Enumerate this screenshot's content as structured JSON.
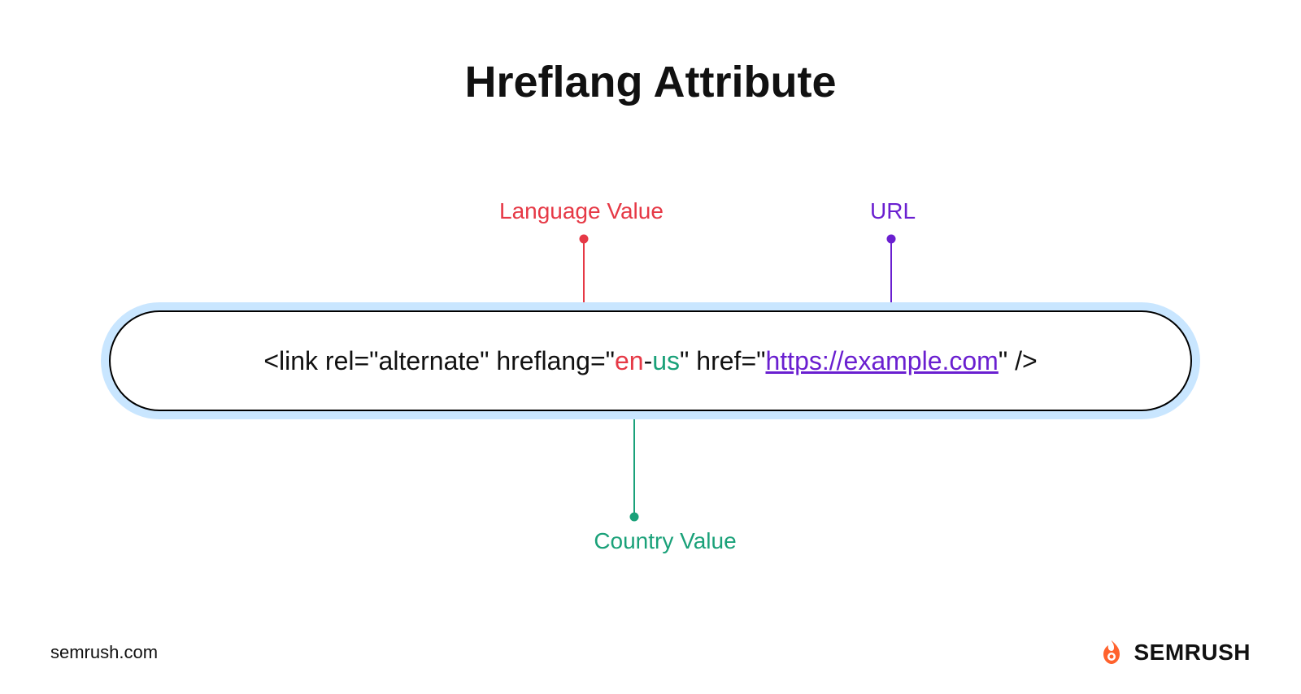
{
  "title": "Hreflang Attribute",
  "annotations": {
    "language": "Language Value",
    "url": "URL",
    "country": "Country Value"
  },
  "code": {
    "prefix": "<link rel=\"alternate\" hreflang=\"",
    "language_token": "en",
    "separator": "-",
    "country_token": "us",
    "mid": "\" href=\"",
    "url_token": "https://example.com",
    "suffix": "\" />"
  },
  "footer": {
    "site": "semrush.com",
    "brand": "SEMRUSH"
  },
  "colors": {
    "language": "#e63946",
    "country": "#1aa179",
    "url": "#6a1fd0",
    "pill_glow": "#c9e6ff",
    "brand_orange": "#ff622d"
  }
}
